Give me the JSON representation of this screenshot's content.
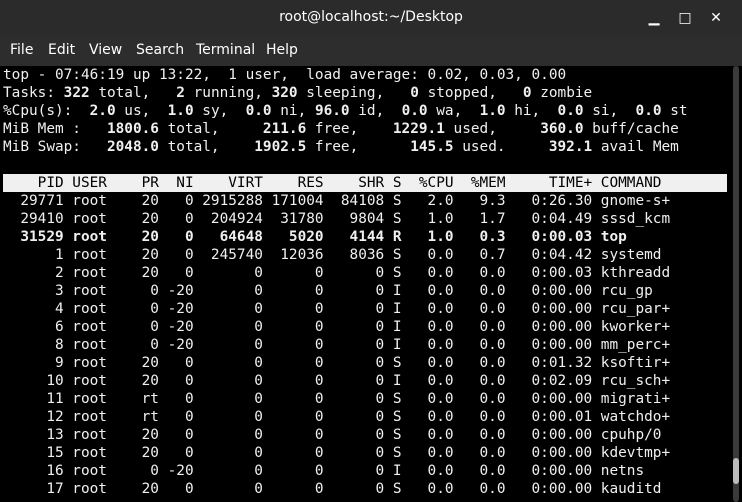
{
  "window": {
    "title": "root@localhost:~/Desktop",
    "minimize_glyph": "▁",
    "maximize_glyph": "□",
    "close_glyph": "✕"
  },
  "menu": [
    "File",
    "Edit",
    "View",
    "Search",
    "Terminal",
    "Help"
  ],
  "summary": {
    "uptime": "top - 07:46:19 up 13:22,  1 user,  load average: 0.02, 0.03, 0.00",
    "tasks_parts": [
      [
        "Tasks: ",
        false
      ],
      [
        "322",
        true
      ],
      [
        " total,   ",
        false
      ],
      [
        "2",
        true
      ],
      [
        " running, ",
        false
      ],
      [
        "320",
        true
      ],
      [
        " sleeping,   ",
        false
      ],
      [
        "0",
        true
      ],
      [
        " stopped,   ",
        false
      ],
      [
        "0",
        true
      ],
      [
        " zombie",
        false
      ]
    ],
    "cpu_parts": [
      [
        "%Cpu(s):  ",
        false
      ],
      [
        "2.0",
        true
      ],
      [
        " us,  ",
        false
      ],
      [
        "1.0",
        true
      ],
      [
        " sy,  ",
        false
      ],
      [
        "0.0",
        true
      ],
      [
        " ni, ",
        false
      ],
      [
        "96.0",
        true
      ],
      [
        " id,  ",
        false
      ],
      [
        "0.0",
        true
      ],
      [
        " wa,  ",
        false
      ],
      [
        "1.0",
        true
      ],
      [
        " hi,  ",
        false
      ],
      [
        "0.0",
        true
      ],
      [
        " si,  ",
        false
      ],
      [
        "0.0",
        true
      ],
      [
        " st",
        false
      ]
    ],
    "mem_parts": [
      [
        "MiB Mem :   ",
        false
      ],
      [
        "1800.6",
        true
      ],
      [
        " total,     ",
        false
      ],
      [
        "211.6",
        true
      ],
      [
        " free,    ",
        false
      ],
      [
        "1229.1",
        true
      ],
      [
        " used,     ",
        false
      ],
      [
        "360.0",
        true
      ],
      [
        " buff/cache",
        false
      ]
    ],
    "swap_parts": [
      [
        "MiB Swap:   ",
        false
      ],
      [
        "2048.0",
        true
      ],
      [
        " total,    ",
        false
      ],
      [
        "1902.5",
        true
      ],
      [
        " free,      ",
        false
      ],
      [
        "145.5",
        true
      ],
      [
        " used.     ",
        false
      ],
      [
        "392.1",
        true
      ],
      [
        " avail Mem",
        false
      ]
    ]
  },
  "table": {
    "headers": [
      "PID",
      "USER",
      "PR",
      "NI",
      "VIRT",
      "RES",
      "SHR",
      "S",
      "%CPU",
      "%MEM",
      "TIME+",
      "COMMAND"
    ],
    "rows": [
      [
        "29771",
        "root",
        "20",
        "0",
        "2915288",
        "171004",
        "84108",
        "S",
        "2.0",
        "9.3",
        "0:26.30",
        "gnome-s+"
      ],
      [
        "29410",
        "root",
        "20",
        "0",
        "204924",
        "31780",
        "9804",
        "S",
        "1.0",
        "1.7",
        "0:04.49",
        "sssd_kcm"
      ],
      [
        "31529",
        "root",
        "20",
        "0",
        "64648",
        "5020",
        "4144",
        "R",
        "1.0",
        "0.3",
        "0:00.03",
        "top"
      ],
      [
        "1",
        "root",
        "20",
        "0",
        "245740",
        "12036",
        "8036",
        "S",
        "0.0",
        "0.7",
        "0:04.42",
        "systemd"
      ],
      [
        "2",
        "root",
        "20",
        "0",
        "0",
        "0",
        "0",
        "S",
        "0.0",
        "0.0",
        "0:00.03",
        "kthreadd"
      ],
      [
        "3",
        "root",
        "0",
        "-20",
        "0",
        "0",
        "0",
        "I",
        "0.0",
        "0.0",
        "0:00.00",
        "rcu_gp"
      ],
      [
        "4",
        "root",
        "0",
        "-20",
        "0",
        "0",
        "0",
        "I",
        "0.0",
        "0.0",
        "0:00.00",
        "rcu_par+"
      ],
      [
        "6",
        "root",
        "0",
        "-20",
        "0",
        "0",
        "0",
        "I",
        "0.0",
        "0.0",
        "0:00.00",
        "kworker+"
      ],
      [
        "8",
        "root",
        "0",
        "-20",
        "0",
        "0",
        "0",
        "I",
        "0.0",
        "0.0",
        "0:00.00",
        "mm_perc+"
      ],
      [
        "9",
        "root",
        "20",
        "0",
        "0",
        "0",
        "0",
        "S",
        "0.0",
        "0.0",
        "0:01.32",
        "ksoftir+"
      ],
      [
        "10",
        "root",
        "20",
        "0",
        "0",
        "0",
        "0",
        "I",
        "0.0",
        "0.0",
        "0:02.09",
        "rcu_sch+"
      ],
      [
        "11",
        "root",
        "rt",
        "0",
        "0",
        "0",
        "0",
        "S",
        "0.0",
        "0.0",
        "0:00.00",
        "migrati+"
      ],
      [
        "12",
        "root",
        "rt",
        "0",
        "0",
        "0",
        "0",
        "S",
        "0.0",
        "0.0",
        "0:00.01",
        "watchdo+"
      ],
      [
        "13",
        "root",
        "20",
        "0",
        "0",
        "0",
        "0",
        "S",
        "0.0",
        "0.0",
        "0:00.00",
        "cpuhp/0"
      ],
      [
        "15",
        "root",
        "20",
        "0",
        "0",
        "0",
        "0",
        "S",
        "0.0",
        "0.0",
        "0:00.00",
        "kdevtmp+"
      ],
      [
        "16",
        "root",
        "0",
        "-20",
        "0",
        "0",
        "0",
        "I",
        "0.0",
        "0.0",
        "0:00.00",
        "netns"
      ],
      [
        "17",
        "root",
        "20",
        "0",
        "0",
        "0",
        "0",
        "S",
        "0.0",
        "0.0",
        "0:00.00",
        "kauditd"
      ]
    ],
    "highlighted_pid": "31529"
  },
  "colors": {
    "terminal_bg": "#000000",
    "terminal_fg": "#f0f0f0",
    "header_bg": "#f0f0f0",
    "titlebar_bg": "#2b2b2b",
    "menubar_bg": "#2d2d2d"
  }
}
